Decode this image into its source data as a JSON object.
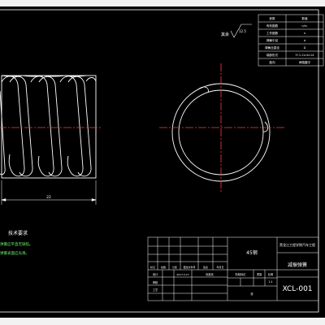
{
  "parameter_table": {
    "rows": [
      {
        "name": "参数",
        "value": "数值"
      },
      {
        "name": "有效圈数",
        "value": "n/n₁"
      },
      {
        "name": "工作圈数",
        "value": "n"
      },
      {
        "name": "弹簧中径",
        "value": "d"
      },
      {
        "name": "弹簧丝直径",
        "value": "D"
      },
      {
        "name": "端部形式",
        "value": "YI 1.2×4×14"
      },
      {
        "name": "旋向",
        "value": "两端磨平"
      }
    ]
  },
  "surface_note": "其余",
  "roughness_value": "12.5",
  "dimension_length": "22",
  "tech_req": {
    "title": "技术要求",
    "lines": [
      "弹簧应平直无缺陷。",
      "弹簧表面应光滑。"
    ]
  },
  "title_block": {
    "material": "45钢",
    "school": "黑龙江工程学院汽车工程",
    "part_name": "减振弹簧",
    "drawing_no": "XCL-001",
    "scale_label": "比例",
    "scale_value": "1:1",
    "weight_label": "重量",
    "sheet_label": "张",
    "designer_label": "设计",
    "check_label": "审核",
    "approve_label": "工艺",
    "std_label": "标准化",
    "stage_label": "阶段标记",
    "date_value": "2017.5.27",
    "headers": [
      "标记",
      "处数",
      "分区",
      "更改文件号",
      "签名",
      "年月日"
    ]
  }
}
